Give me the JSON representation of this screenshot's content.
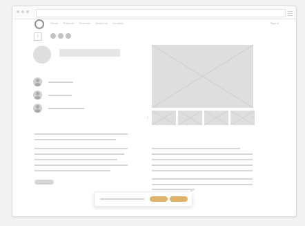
{
  "nav": {
    "items": [
      "Home",
      "Projects",
      "Services",
      "About us",
      "Contact"
    ],
    "right_link": "Sign in"
  },
  "icons": {
    "logo": "logo-circle-icon",
    "back": "chevron-left-icon",
    "menu": "hamburger-icon"
  },
  "colors": {
    "accent": "#e0b369",
    "placeholder": "#dedede"
  }
}
